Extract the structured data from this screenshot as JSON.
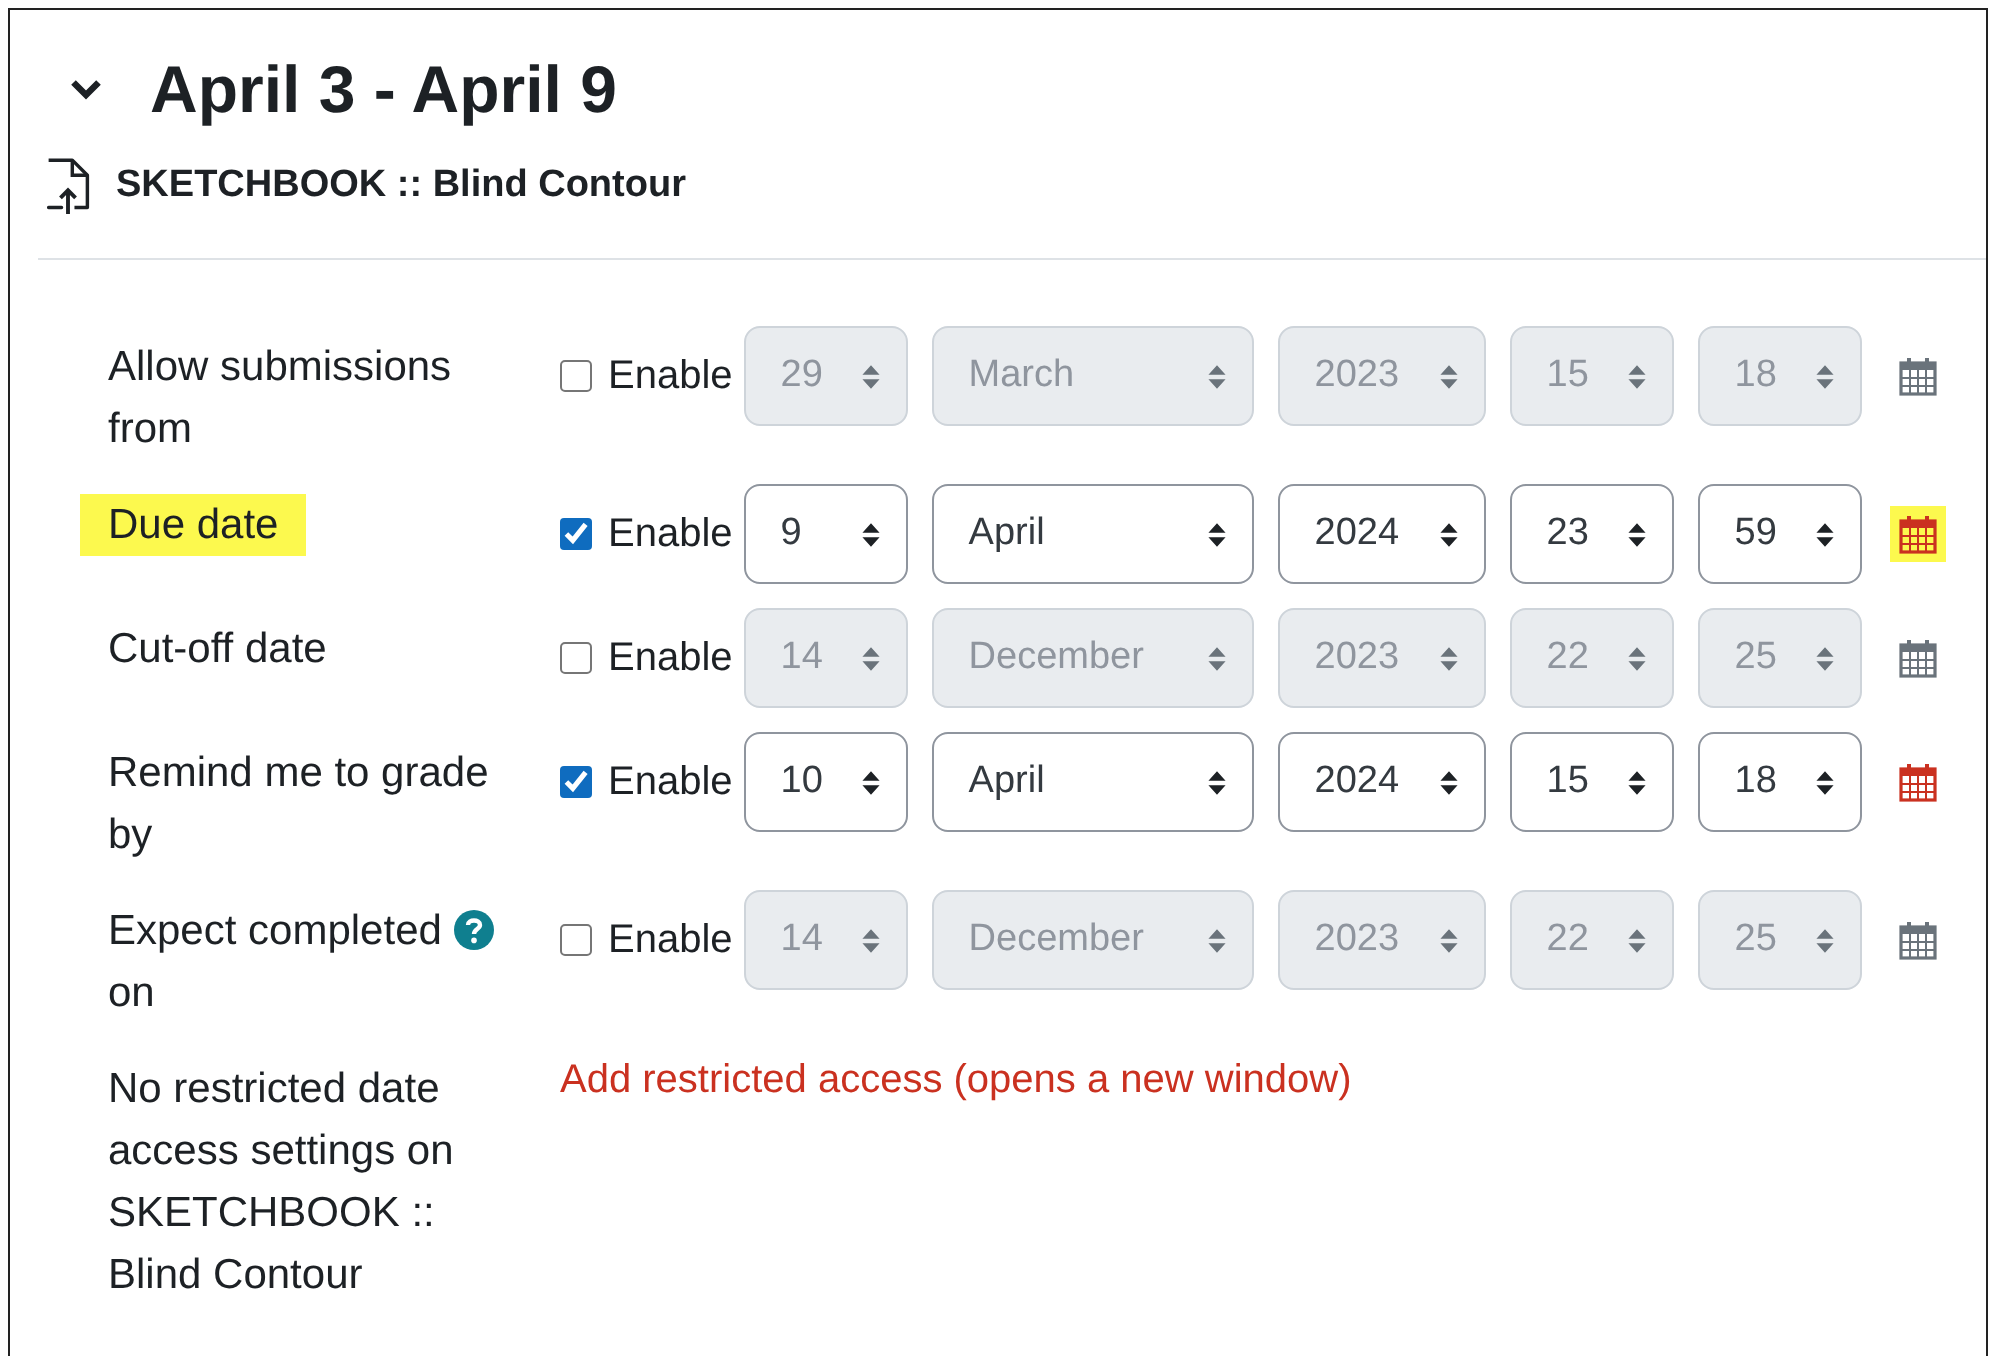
{
  "section": {
    "title": "April 3 - April 9",
    "expanded": true,
    "activity": "SKETCHBOOK :: Blind Contour"
  },
  "rows": [
    {
      "label": "Allow submissions from",
      "highlighted": false,
      "help": false,
      "enabled": false,
      "enable_label": "Enable",
      "fields": [
        "29",
        "March",
        "2023",
        "15",
        "18"
      ]
    },
    {
      "label": "Due date",
      "highlighted": true,
      "help": false,
      "enabled": true,
      "enable_label": "Enable",
      "fields": [
        "9",
        "April",
        "2024",
        "23",
        "59"
      ]
    },
    {
      "label": "Cut-off date",
      "highlighted": false,
      "help": false,
      "enabled": false,
      "enable_label": "Enable",
      "fields": [
        "14",
        "December",
        "2023",
        "22",
        "25"
      ]
    },
    {
      "label": "Remind me to grade by",
      "highlighted": false,
      "help": false,
      "enabled": true,
      "enable_label": "Enable",
      "fields": [
        "10",
        "April",
        "2024",
        "15",
        "18"
      ]
    },
    {
      "label": "Expect completed",
      "label_end": "on",
      "highlighted": false,
      "help": true,
      "enabled": false,
      "enable_label": "Enable",
      "fields": [
        "14",
        "December",
        "2023",
        "22",
        "25"
      ]
    }
  ],
  "restriction": {
    "note": "No restricted date access settings on SKETCHBOOK :: Blind Contour",
    "link": "Add restricted access (opens a new window)"
  }
}
